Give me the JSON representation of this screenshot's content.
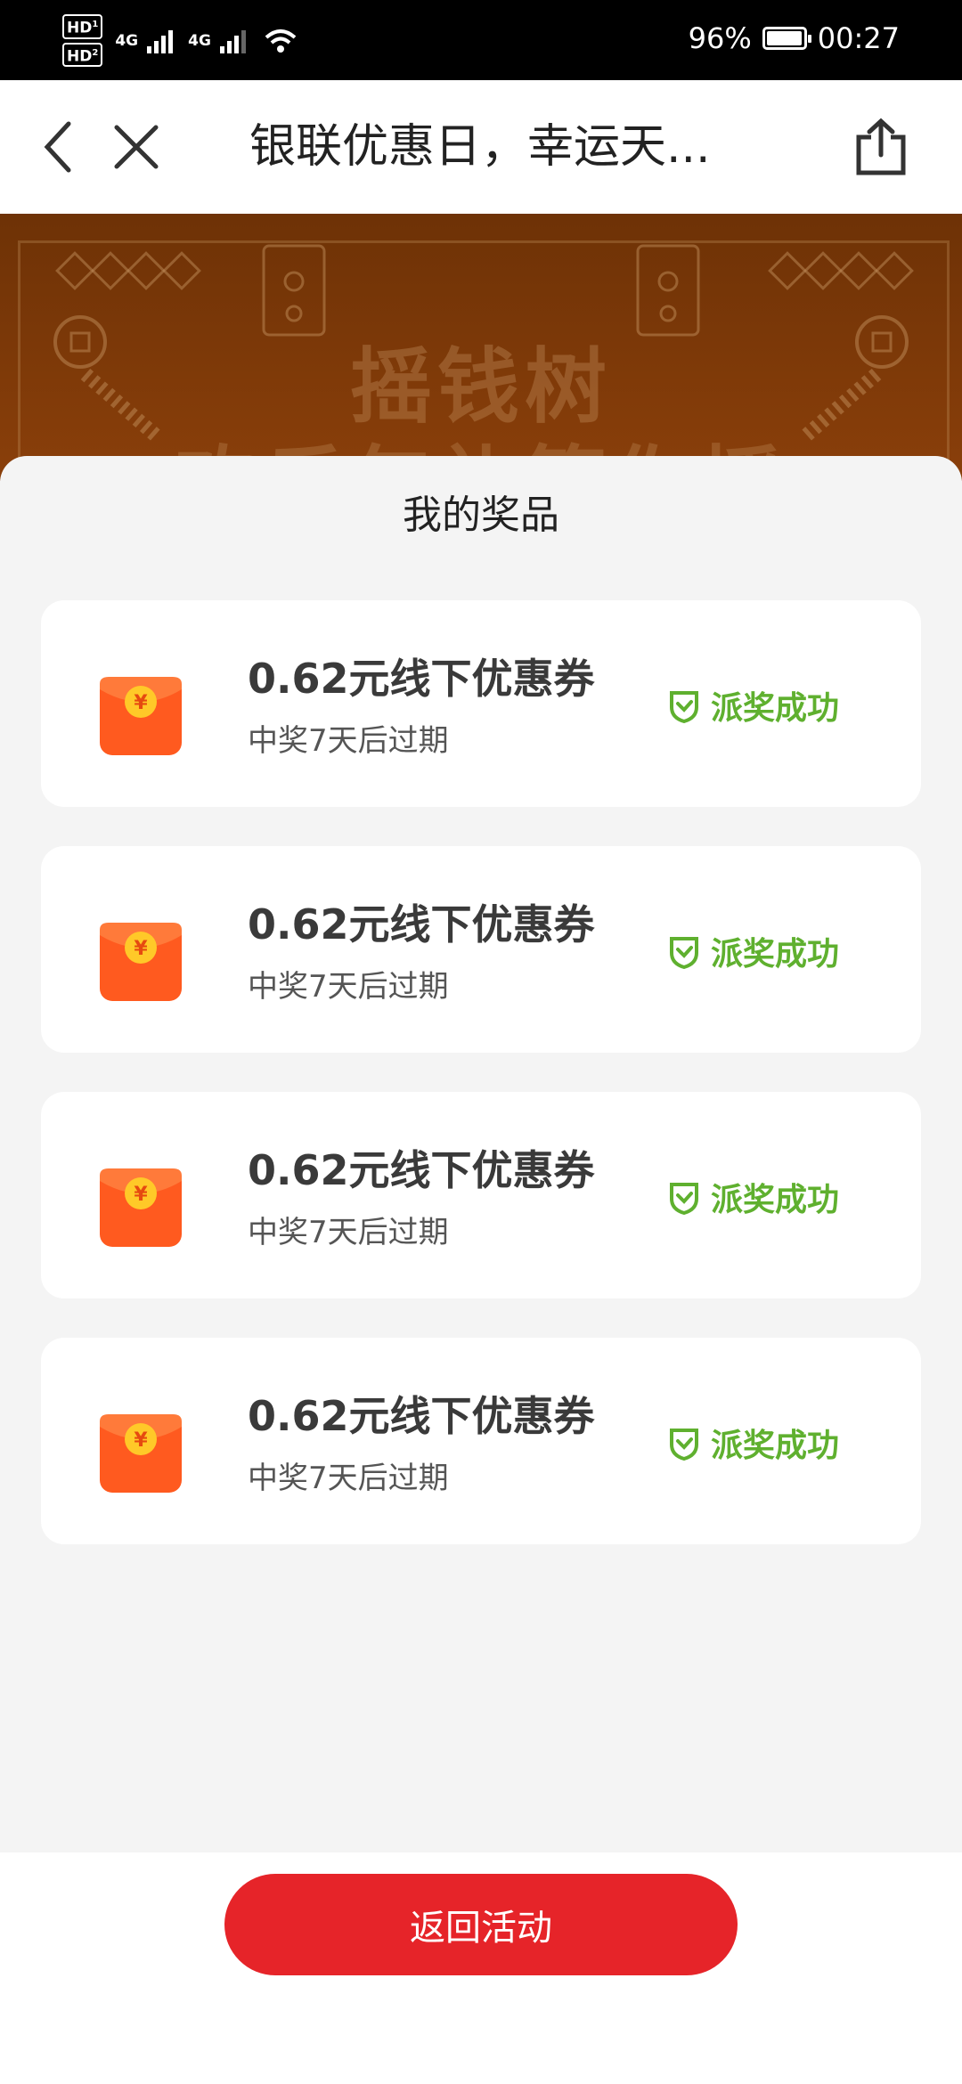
{
  "status_bar": {
    "hd1": "HD",
    "hd2": "HD",
    "sim1": "1",
    "sim2": "2",
    "net1": "4G",
    "net2": "4G",
    "battery": "96%",
    "time": "00:27"
  },
  "nav": {
    "title": "银联优惠日，幸运天...",
    "back_icon": "chevron-left-icon",
    "close_icon": "close-icon",
    "share_icon": "share-icon"
  },
  "banner": {
    "line1": "摇钱树",
    "line2": "欢乐年礼等你摇"
  },
  "sheet": {
    "title": "我的奖品",
    "prizes": [
      {
        "title": "0.62元线下优惠券",
        "subtitle": "中奖7天后过期",
        "status": "派奖成功"
      },
      {
        "title": "0.62元线下优惠券",
        "subtitle": "中奖7天后过期",
        "status": "派奖成功"
      },
      {
        "title": "0.62元线下优惠券",
        "subtitle": "中奖7天后过期",
        "status": "派奖成功"
      },
      {
        "title": "0.62元线下优惠券",
        "subtitle": "中奖7天后过期",
        "status": "派奖成功"
      }
    ]
  },
  "bottom": {
    "back_label": "返回活动"
  },
  "colors": {
    "accent_red": "#e62429",
    "success_green": "#5fb02f",
    "envelope_orange": "#ff5a1f",
    "coin_yellow": "#ffc928"
  }
}
